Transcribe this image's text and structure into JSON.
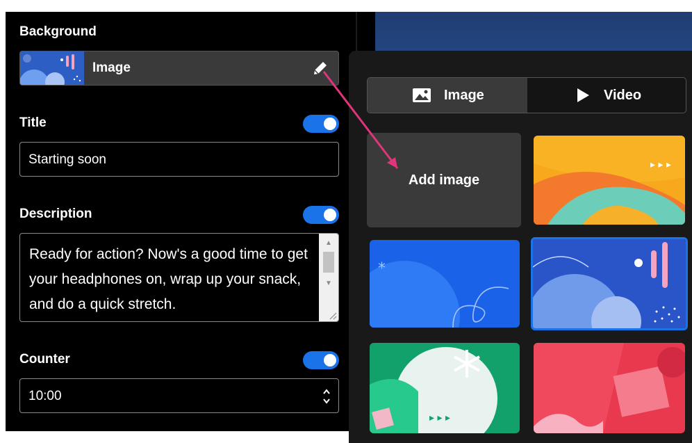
{
  "settings": {
    "background": {
      "label": "Background",
      "selected_type": "Image",
      "edit_icon": "pencil-icon"
    },
    "title": {
      "label": "Title",
      "enabled": true,
      "value": "Starting soon"
    },
    "description": {
      "label": "Description",
      "enabled": true,
      "value": "Ready for action? Now's a good time to get your headphones on, wrap up your snack, and do a quick stretch."
    },
    "counter": {
      "label": "Counter",
      "enabled": true,
      "value": "10:00"
    }
  },
  "picker": {
    "tabs": [
      {
        "label": "Image",
        "icon": "image-icon",
        "active": true
      },
      {
        "label": "Video",
        "icon": "play-icon",
        "active": false
      }
    ],
    "add_label": "Add image",
    "tiles": [
      {
        "name": "orange-yellow-waves"
      },
      {
        "name": "blue-swirl"
      },
      {
        "name": "blue-circles-pink-bars",
        "selected": true
      },
      {
        "name": "green-asterisk"
      },
      {
        "name": "red-pink-shapes"
      }
    ]
  },
  "colors": {
    "accent": "#1a73e8",
    "annotation_arrow": "#e0357a",
    "panel_bg": "#000000",
    "picker_bg": "#191919"
  }
}
